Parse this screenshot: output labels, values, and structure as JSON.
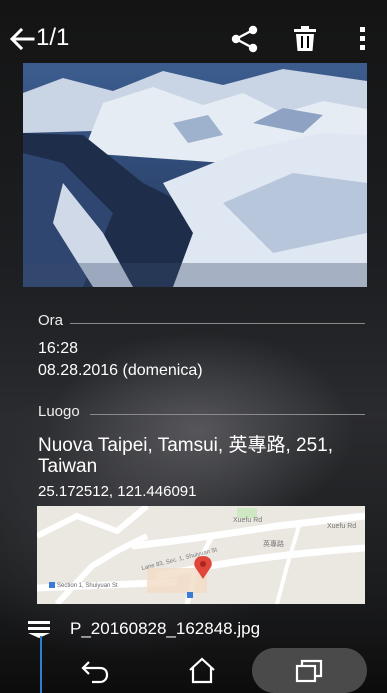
{
  "header": {
    "counter": "1/1",
    "icons": [
      "back-arrow-icon",
      "share-icon",
      "trash-icon",
      "more-vert-icon"
    ]
  },
  "details": {
    "time_section": {
      "title": "Ora",
      "time": "16:28",
      "date": "08.28.2016 (domenica)"
    },
    "location_section": {
      "title": "Luogo",
      "address": "Nuova Taipei, Tamsui, 英專路, 251, Taiwan",
      "coordinates": "25.172512, 121.446091"
    },
    "map": {
      "labels": [
        "Xuefu Rd",
        "Xuefu Rd",
        "Lane 83, Sec. 1, Shuiyuan St",
        "Section 1, Shuiyuan St",
        "英專路"
      ]
    }
  },
  "footer": {
    "filename": "P_20160828_162848.jpg"
  },
  "navbar": {
    "icons": [
      "nav-back-icon",
      "nav-home-icon",
      "nav-recent-apps-icon"
    ]
  },
  "colors": {
    "accent": "#2d7fd0",
    "marker": "#e2453a",
    "nav_pill": "#4a4a4a"
  }
}
